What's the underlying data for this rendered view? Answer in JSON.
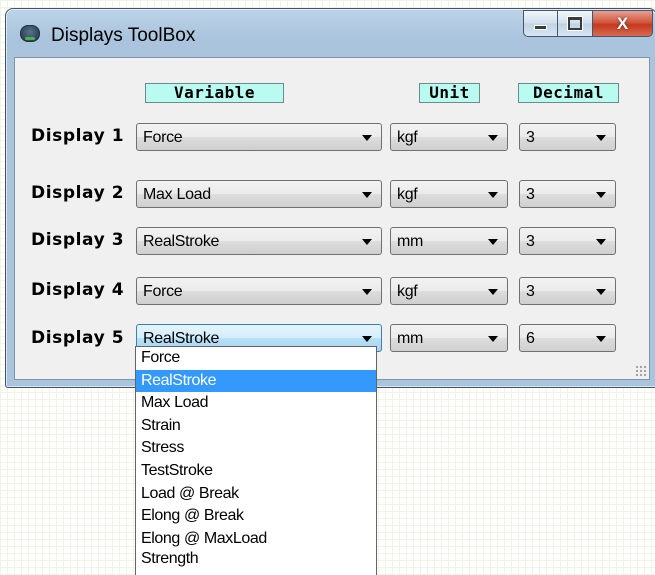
{
  "window": {
    "title": "Displays ToolBox",
    "close_glyph": "X"
  },
  "headers": {
    "variable": "Variable",
    "unit": "Unit",
    "decimal": "Decimal"
  },
  "rows": [
    {
      "label": "Display 1",
      "variable": "Force",
      "unit": "kgf",
      "decimal": "3"
    },
    {
      "label": "Display 2",
      "variable": "Max Load",
      "unit": "kgf",
      "decimal": "3"
    },
    {
      "label": "Display 3",
      "variable": "RealStroke",
      "unit": "mm",
      "decimal": "3"
    },
    {
      "label": "Display 4",
      "variable": "Force",
      "unit": "kgf",
      "decimal": "3"
    },
    {
      "label": "Display 5",
      "variable": "RealStroke",
      "unit": "mm",
      "decimal": "6"
    }
  ],
  "dropdown": {
    "selected": "RealStroke",
    "options": [
      "Force",
      "RealStroke",
      "Max Load",
      "Strain",
      "Stress",
      "TestStroke",
      "Load @ Break",
      "Elong @ Break",
      "Elong @ MaxLoad",
      "Strength"
    ]
  },
  "colors": {
    "header_bg": "#b9fbf0",
    "selection": "#3399ff",
    "close_button": "#c4391e"
  }
}
